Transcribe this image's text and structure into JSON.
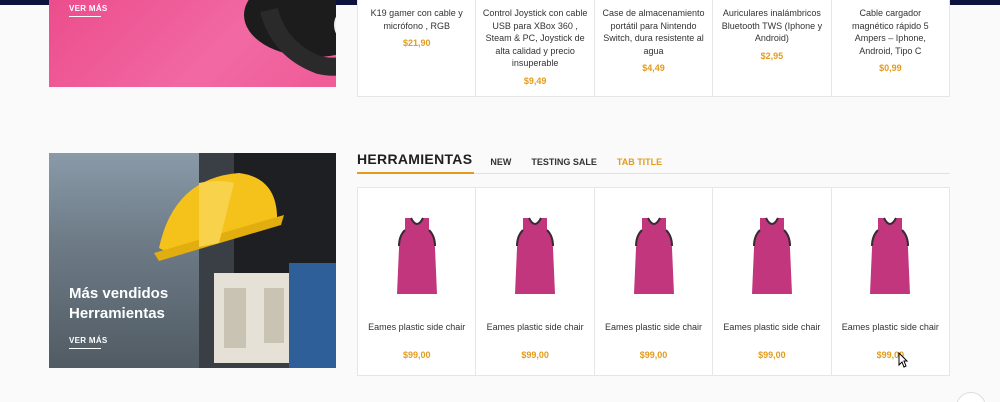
{
  "banner_top": {
    "link_label": "VER MÁS"
  },
  "top_products": [
    {
      "title": "K19 gamer con cable y micrófono , RGB",
      "price": "$21,90"
    },
    {
      "title": "Control Joystick con cable USB para XBox 360 , Steam & PC, Joystick de alta calidad y precio insuperable",
      "price": "$9,49"
    },
    {
      "title": "Case de almacenamiento portátil para Nintendo Switch, dura resistente al agua",
      "price": "$4,49"
    },
    {
      "title": "Auriculares inalámbricos Bluetooth TWS (Iphone y Android)",
      "price": "$2,95"
    },
    {
      "title": "Cable cargador magnético rápido 5 Ampers – Iphone, Android, Tipo C",
      "price": "$0,99"
    }
  ],
  "banner_bottom": {
    "headline_line1": "Más vendidos",
    "headline_line2": "Herramientas",
    "link_label": "VER MÁS"
  },
  "tabs": {
    "title": "HERRAMIENTAS",
    "items": [
      "NEW",
      "TESTING SALE",
      "TAB TITLE"
    ],
    "active": "TAB TITLE"
  },
  "bottom_products": [
    {
      "title": "Eames plastic side chair",
      "price": "$99,00"
    },
    {
      "title": "Eames plastic side chair",
      "price": "$99,00"
    },
    {
      "title": "Eames plastic side chair",
      "price": "$99,00"
    },
    {
      "title": "Eames plastic side chair",
      "price": "$99,00"
    },
    {
      "title": "Eames plastic side chair",
      "price": "$99,00"
    }
  ],
  "colors": {
    "accent": "#e39b1d",
    "banner_pink": "#ec4d8c",
    "product_magenta": "#c2367e",
    "top_bar": "#0b1240"
  }
}
